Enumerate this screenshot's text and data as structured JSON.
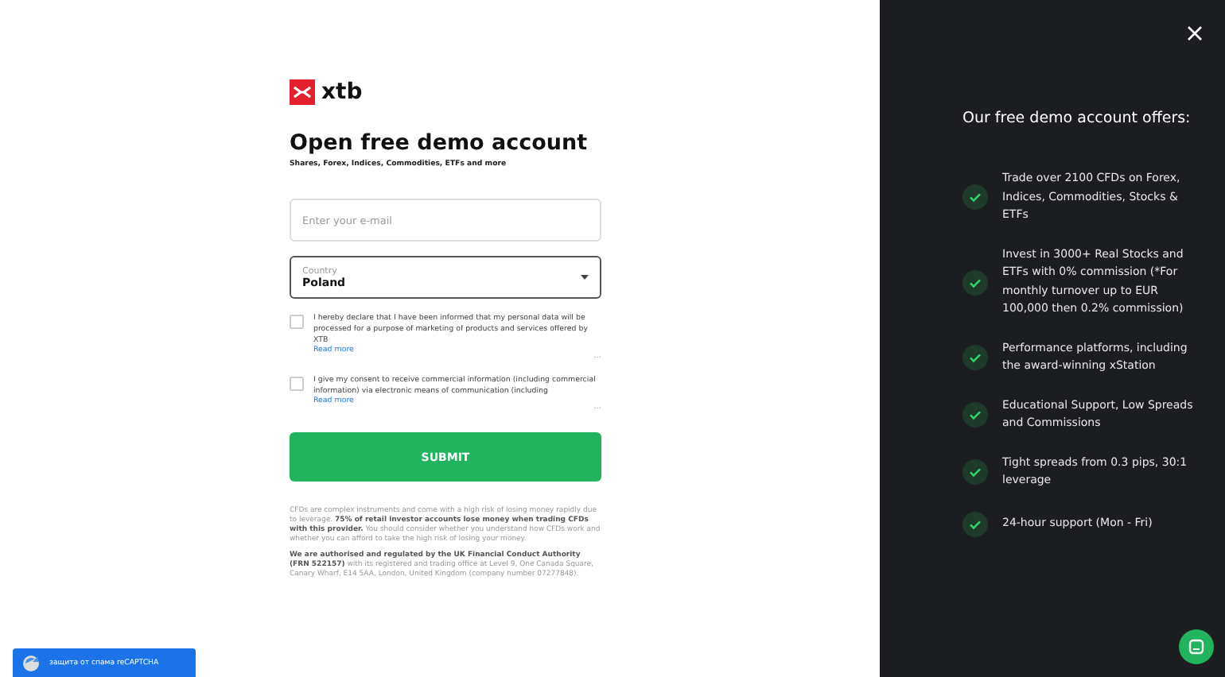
{
  "logo": {
    "text": "xtb"
  },
  "form": {
    "title": "Open free demo account",
    "subtitle": "Shares, Forex, Indices, Commodities, ETFs and more",
    "email": {
      "placeholder": "Enter your e-mail"
    },
    "country": {
      "label": "Country",
      "value": "Poland"
    },
    "consents": [
      {
        "text": "I hereby declare that I have been informed that my personal data will be processed for a purpose of marketing of products and services offered by XTB",
        "link": "Read more",
        "more": "…",
        "checked": false
      },
      {
        "text": "I give my consent to receive commercial information (including commercial information) via electronic means of communication (including",
        "link": "Read more",
        "more": "…",
        "checked": false
      }
    ],
    "submit": "SUBMIT",
    "disclaimers": [
      "CFDs are complex instruments and come with a high risk of losing money rapidly due to leverage. **75% of retail investor accounts lose money when trading CFDs with this provider.** You should consider whether you understand how CFDs work and whether you can afford to take the high risk of losing your money.",
      "**We are authorised and regulated by the UK Financial Conduct Authority (FRN 522157)** with its registered and trading office at Level 9, One Canada Square, Canary Wharf, E14 5AA, London, United Kingdom (company number 07277848)."
    ]
  },
  "recaptcha": {
    "label": "защита от спама reCAPTCHA"
  },
  "offers": {
    "title": "Our free demo account offers:",
    "items": [
      "Trade over 2100 CFDs on Forex, Indices, Commodities, Stocks & ETFs",
      "Invest in 3000+ Real Stocks and ETFs with 0% commission (*For monthly turnover up to EUR 100,000 then 0.2% commission)",
      "Performance platforms, including the award-winning xStation",
      "Educational Support, Low Spreads and Commissions",
      "Tight spreads from 0.3 pips, 30:1 leverage",
      "24-hour support (Mon - Fri)"
    ]
  }
}
